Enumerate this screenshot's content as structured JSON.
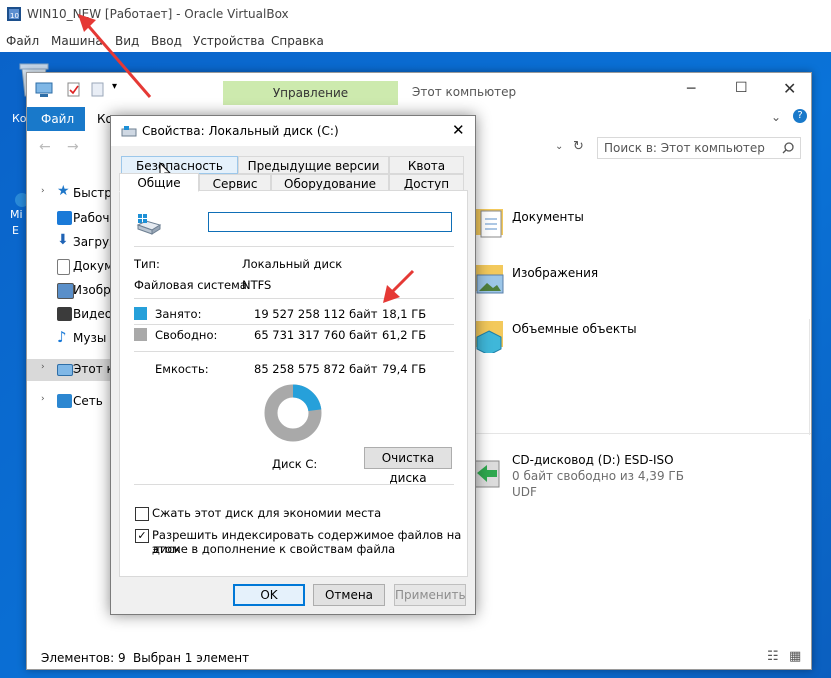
{
  "vbox": {
    "title": "WIN10_NEW [Работает] - Oracle VirtualBox",
    "menu": [
      "Файл",
      "Машина",
      "Вид",
      "Ввод",
      "Устройства",
      "Справка"
    ]
  },
  "desktop": {
    "icon_labels": [
      "Ко",
      "Mi",
      "E"
    ]
  },
  "explorer": {
    "window_title": "Этот компьютер",
    "context_tab": "Управление",
    "ribbon_tabs": [
      "Файл",
      "Ко"
    ],
    "search_placeholder": "Поиск в: Этот компьютер",
    "nav_items": [
      {
        "label": "Быстры",
        "color": "#1f77c9"
      },
      {
        "label": "Рабоч",
        "color": "#1a7ad8"
      },
      {
        "label": "Загруз",
        "color": "#1f63b5"
      },
      {
        "label": "Докум",
        "color": "#7a7a7a"
      },
      {
        "label": "Изобр",
        "color": "#5a8fc9"
      },
      {
        "label": "Видео",
        "color": "#3b3b3b"
      },
      {
        "label": "Музы",
        "color": "#1a7ad8"
      },
      {
        "label": "Этот ко",
        "color": "#2c87d1"
      },
      {
        "label": "Сеть",
        "color": "#2c87d1"
      }
    ],
    "folders": [
      "Документы",
      "Изображения",
      "Объемные объекты"
    ],
    "cd": {
      "name": "CD-дисковод (D:) ESD-ISO",
      "free": "0 байт свободно из 4,39 ГБ",
      "fs": "UDF"
    },
    "status": {
      "count": "Элементов: 9",
      "selected": "Выбран 1 элемент"
    }
  },
  "dialog": {
    "title": "Свойства: Локальный диск (C:)",
    "tabs_row1": [
      "Безопасность",
      "Предыдущие версии",
      "Квота"
    ],
    "tabs_row2": [
      "Общие",
      "Сервис",
      "Оборудование",
      "Доступ"
    ],
    "name_value": "",
    "type_label": "Тип:",
    "type_value": "Локальный диск",
    "fs_label": "Файловая система:",
    "fs_value": "NTFS",
    "used_label": "Занято:",
    "used_bytes": "19 527 258 112 байт",
    "used_gb": "18,1 ГБ",
    "free_label": "Свободно:",
    "free_bytes": "65 731 317 760 байт",
    "free_gb": "61,2 ГБ",
    "capacity_label": "Емкость:",
    "capacity_bytes": "85 258 575 872 байт",
    "capacity_gb": "79,4 ГБ",
    "disk_label": "Диск C:",
    "cleanup_button": "Очистка диска",
    "compress_label": "Сжать этот диск для экономии места",
    "index_label_1": "Разрешить индексировать содержимое файлов на этом",
    "index_label_2": "диске в дополнение к свойствам файла",
    "compress_checked": false,
    "index_checked": true,
    "ok_button": "OK",
    "cancel_button": "Отмена",
    "apply_button": "Применить",
    "used_fraction": 0.229,
    "colors": {
      "used": "#26a0da",
      "free": "#a9a9a9"
    }
  }
}
